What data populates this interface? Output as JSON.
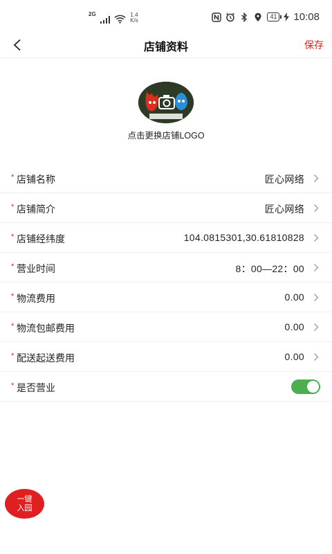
{
  "status_bar": {
    "network": "2G",
    "speed_value": "1.4",
    "speed_unit": "K/s",
    "battery": "41",
    "time": "10:08",
    "icons": [
      "signal-icon",
      "wifi-icon",
      "nfc-icon",
      "alarm-icon",
      "bluetooth-icon",
      "location-icon",
      "battery-icon",
      "charging-icon"
    ]
  },
  "nav": {
    "title": "店铺资料",
    "save_label": "保存",
    "back_icon": "chevron-left-icon"
  },
  "logo": {
    "hint": "点击更换店铺LOGO"
  },
  "form": {
    "required_mark": "*",
    "rows": [
      {
        "label": "店铺名称",
        "value": "匠心网络"
      },
      {
        "label": "店铺简介",
        "value": "匠心网络"
      },
      {
        "label": "店铺经纬度",
        "value": "104.0815301,30.61810828"
      },
      {
        "label": "营业时间",
        "value": "8：00—22：00"
      },
      {
        "label": "物流费用",
        "value": "0.00"
      },
      {
        "label": "物流包邮费用",
        "value": "0.00"
      },
      {
        "label": "配送起送费用",
        "value": "0.00"
      }
    ],
    "open_toggle": {
      "label": "是否营业",
      "on": true
    }
  },
  "fab": {
    "line1": "一键",
    "line2": "入园"
  },
  "colors": {
    "accent": "#e02020",
    "toggle_on": "#4cae4f",
    "divider": "#eeeeee"
  }
}
